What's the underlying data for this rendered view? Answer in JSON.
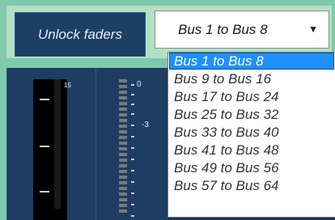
{
  "toolbar": {
    "unlock_label": "Unlock faders",
    "bus_select": {
      "value": "Bus 1 to Bus 8",
      "arrow_icon": "caret-down-icon"
    }
  },
  "dropdown": {
    "options": [
      "Bus 1 to Bus 8",
      "Bus 9 to Bus 16",
      "Bus 17 to Bus 24",
      "Bus 25 to Bus 32",
      "Bus 33 to Bus 40",
      "Bus 41 to Bus 48",
      "Bus 49 to Bus 56",
      "Bus 57 to Bus 64"
    ],
    "selected_index": 0
  },
  "mixer": {
    "fader_number": "15",
    "meter_labels": [
      "0",
      "-3"
    ]
  },
  "colors": {
    "accent": "#1e90ff",
    "panel_bg": "#1c3d64",
    "toolbar_bg": "#b3e0c5",
    "outer_bg": "#7fc9ac"
  }
}
